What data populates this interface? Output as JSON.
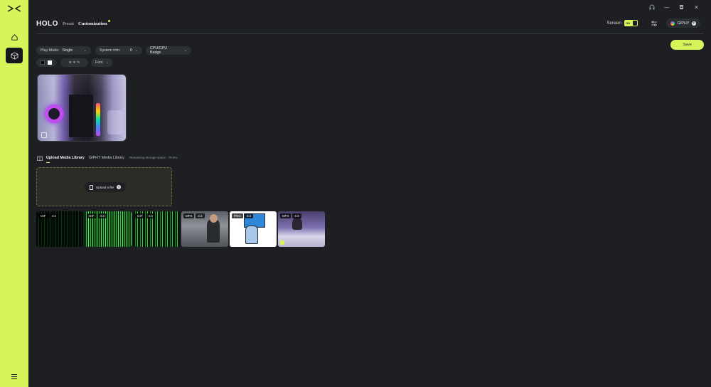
{
  "window": {
    "controls": [
      "headset-icon",
      "minimize",
      "restore",
      "close"
    ]
  },
  "header": {
    "brand": "HOLO",
    "tabs": [
      {
        "label": "Preset"
      },
      {
        "label": "Customization"
      }
    ],
    "screen_label": "Screen",
    "screen_toggle": "ON",
    "giphy_label": "GIPHY",
    "help": "?"
  },
  "actions": {
    "save_label": "Save"
  },
  "controls": {
    "play_mode": {
      "label": "Play Mode:",
      "value": "Single"
    },
    "system_info": {
      "label": "System Info:",
      "value": "0"
    },
    "badge": {
      "value": "CPU/GPU Badge"
    },
    "align": "≡ ≑ ≒",
    "font_label": "Font"
  },
  "library": {
    "tabs": [
      {
        "label": "Upload Media Library"
      },
      {
        "label": "GIPHY Media Library"
      }
    ],
    "storage_text": "Remaining storage space : 79.8%",
    "upload_label": "Upload a file",
    "help": "?"
  },
  "media": [
    {
      "type": "GIF",
      "ratio": "4:3"
    },
    {
      "type": "GIF",
      "ratio": "4:3"
    },
    {
      "type": "GIF",
      "ratio": "4:3"
    },
    {
      "type": "MP4",
      "ratio": "4:3"
    },
    {
      "type": "PNG",
      "ratio": "4:3"
    },
    {
      "type": "MP4",
      "ratio": "4:3"
    }
  ],
  "colors": {
    "accent": "#d7f45a",
    "background": "#1d1f23",
    "panel": "#2c2f34"
  }
}
